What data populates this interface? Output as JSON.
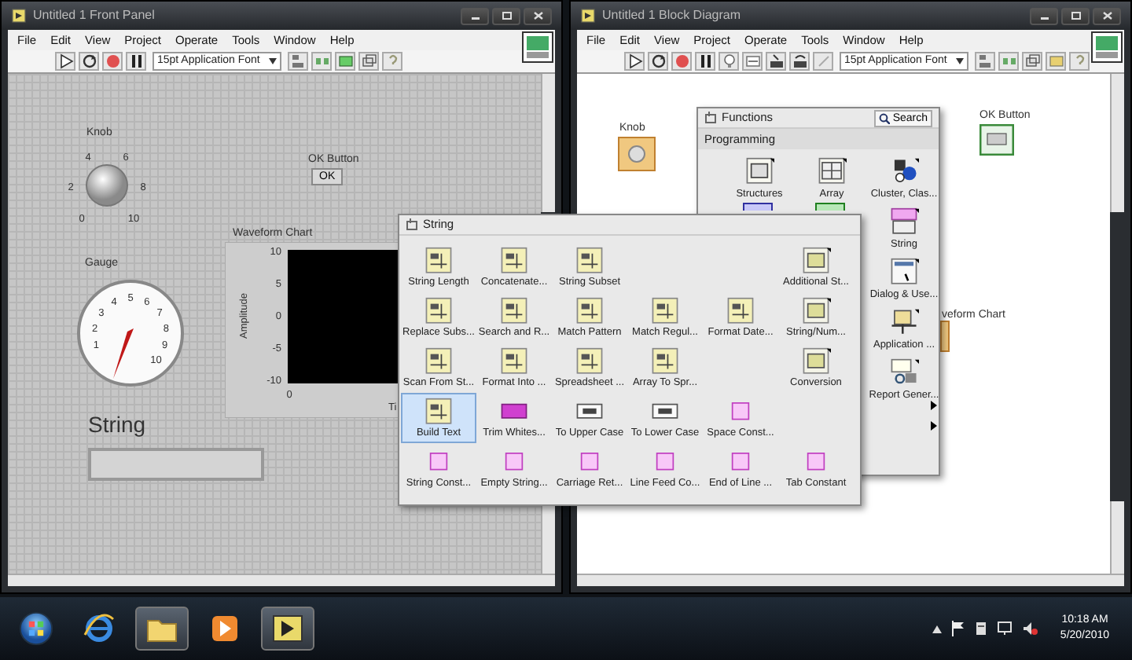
{
  "front_panel": {
    "title": "Untitled 1 Front Panel",
    "menu": [
      "File",
      "Edit",
      "View",
      "Project",
      "Operate",
      "Tools",
      "Window",
      "Help"
    ],
    "font": "15pt Application Font",
    "knob": {
      "label": "Knob",
      "scale": [
        "4",
        "6",
        "2",
        "8",
        "0",
        "10"
      ]
    },
    "ok_button": {
      "label": "OK Button",
      "text": "OK"
    },
    "gauge": {
      "label": "Gauge",
      "scale": [
        "5",
        "4",
        "6",
        "3",
        "7",
        "2",
        "8",
        "1",
        "9",
        "10"
      ]
    },
    "chart": {
      "label": "Waveform Chart",
      "ylabel": "Amplitude",
      "yticks": [
        "10",
        "5",
        "0",
        "-5",
        "-10"
      ],
      "xtick": "0",
      "xlabel": "Ti"
    },
    "string": {
      "label": "String"
    }
  },
  "block_diagram": {
    "title": "Untitled 1 Block Diagram",
    "menu": [
      "File",
      "Edit",
      "View",
      "Project",
      "Operate",
      "Tools",
      "Window",
      "Help"
    ],
    "font": "15pt Application Font",
    "terminals": [
      {
        "label": "Knob",
        "kind": "numeric"
      },
      {
        "label": "OK Button",
        "kind": "boolean"
      },
      {
        "label": "veform Chart",
        "kind": "chart"
      }
    ]
  },
  "functions_palette": {
    "title": "Functions",
    "search": "Search",
    "category": "Programming",
    "items": [
      {
        "label": "Structures"
      },
      {
        "label": "Array"
      },
      {
        "label": "Cluster, Clas..."
      },
      {
        "label": "String"
      },
      {
        "label": "Dialog & Use..."
      },
      {
        "label": "Application ..."
      },
      {
        "label": "Report Gener..."
      }
    ]
  },
  "string_palette": {
    "title": "String",
    "rows": [
      [
        {
          "label": "String Length",
          "kind": "function",
          "selected": false
        },
        {
          "label": "Concatenate...",
          "kind": "function",
          "selected": false
        },
        {
          "label": "String Subset",
          "kind": "function",
          "selected": false
        },
        null,
        null,
        {
          "label": "Additional St...",
          "kind": "subpalette",
          "selected": false
        }
      ],
      [
        {
          "label": "Replace Subs...",
          "kind": "function",
          "selected": false
        },
        {
          "label": "Search and R...",
          "kind": "function",
          "selected": false
        },
        {
          "label": "Match Pattern",
          "kind": "function",
          "selected": false
        },
        {
          "label": "Match Regul...",
          "kind": "function",
          "selected": false
        },
        {
          "label": "Format Date...",
          "kind": "function",
          "selected": false
        },
        {
          "label": "String/Num...",
          "kind": "subpalette",
          "selected": false
        }
      ],
      [
        {
          "label": "Scan From St...",
          "kind": "function",
          "selected": false
        },
        {
          "label": "Format Into ...",
          "kind": "function",
          "selected": false
        },
        {
          "label": "Spreadsheet ...",
          "kind": "function",
          "selected": false
        },
        {
          "label": "Array To Spr...",
          "kind": "function",
          "selected": false
        },
        null,
        {
          "label": "Conversion",
          "kind": "subpalette",
          "selected": false
        }
      ],
      [
        {
          "label": "Build Text",
          "kind": "function",
          "selected": true
        },
        {
          "label": "Trim Whites...",
          "kind": "whitespace",
          "selected": false
        },
        {
          "label": "To Upper Case",
          "kind": "case",
          "selected": false
        },
        {
          "label": "To Lower Case",
          "kind": "case",
          "selected": false
        },
        {
          "label": "Space Const...",
          "kind": "constant",
          "selected": false
        },
        null
      ],
      [
        {
          "label": "String Const...",
          "kind": "constant",
          "selected": false
        },
        {
          "label": "Empty String...",
          "kind": "constant",
          "selected": false
        },
        {
          "label": "Carriage Ret...",
          "kind": "constant",
          "selected": false
        },
        {
          "label": "Line Feed Co...",
          "kind": "constant",
          "selected": false
        },
        {
          "label": "End of Line ...",
          "kind": "constant",
          "selected": false
        },
        {
          "label": "Tab Constant",
          "kind": "constant",
          "selected": false
        }
      ]
    ]
  },
  "taskbar": {
    "time": "10:18 AM",
    "date": "5/20/2010"
  }
}
